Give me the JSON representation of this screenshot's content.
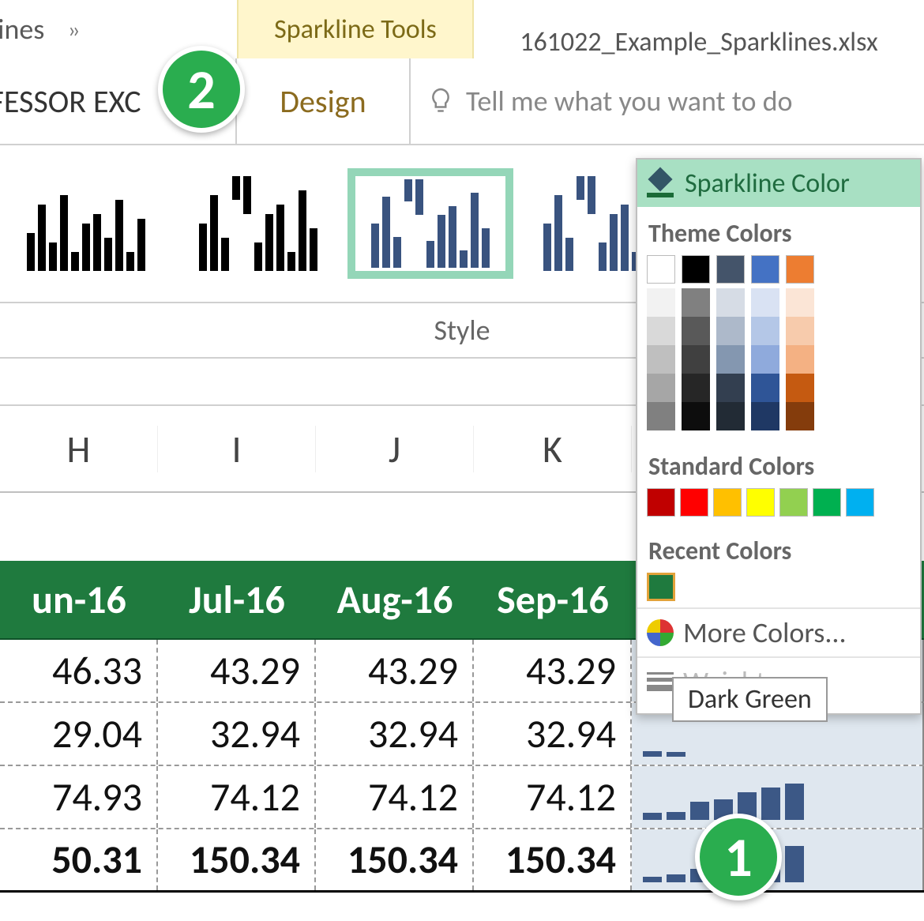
{
  "titlebar": {
    "left_text": "dlines",
    "tools_context": "Sparkline Tools",
    "filename": "161022_Example_Sparklines.xlsx"
  },
  "tabs": {
    "left": "OFESSOR EXC",
    "design": "Design",
    "tellme": "Tell me what you want to do"
  },
  "ribbon": {
    "style_group_label": "Style",
    "sparkline_color_label": "Sparkline Color"
  },
  "color_panel": {
    "theme_heading": "Theme Colors",
    "standard_heading": "Standard Colors",
    "recent_heading": "Recent Colors",
    "more_colors": "More Colors...",
    "weight": "Weight",
    "tooltip": "Dark Green",
    "theme_row1": [
      "#ffffff",
      "#000000",
      "#44546a",
      "#4472c4",
      "#ed7d31"
    ],
    "shade_columns": [
      [
        "#f2f2f2",
        "#d9d9d9",
        "#bfbfbf",
        "#a6a6a6",
        "#808080"
      ],
      [
        "#808080",
        "#595959",
        "#404040",
        "#262626",
        "#0d0d0d"
      ],
      [
        "#d6dce5",
        "#adb9ca",
        "#8497b0",
        "#333f50",
        "#222b35"
      ],
      [
        "#d9e2f3",
        "#b4c7e7",
        "#8faadc",
        "#2f5597",
        "#1f3864"
      ],
      [
        "#fbe5d6",
        "#f7cbac",
        "#f4b183",
        "#c55a11",
        "#843c0c"
      ]
    ],
    "standard_colors": [
      "#c00000",
      "#ff0000",
      "#ffc000",
      "#ffff00",
      "#92d050",
      "#00b050",
      "#00b0f0"
    ],
    "recent_color": "#1f7a3e"
  },
  "columns": [
    "H",
    "I",
    "J",
    "K"
  ],
  "data_header": [
    "un-16",
    "Jul-16",
    "Aug-16",
    "Sep-16"
  ],
  "rows": [
    [
      "46.33",
      "43.29",
      "43.29",
      "43.29"
    ],
    [
      "29.04",
      "32.94",
      "32.94",
      "32.94"
    ],
    [
      "74.93",
      "74.12",
      "74.12",
      "74.12"
    ],
    [
      "50.31",
      "150.34",
      "150.34",
      "150.34"
    ]
  ],
  "callouts": {
    "one": "1",
    "two": "2"
  }
}
